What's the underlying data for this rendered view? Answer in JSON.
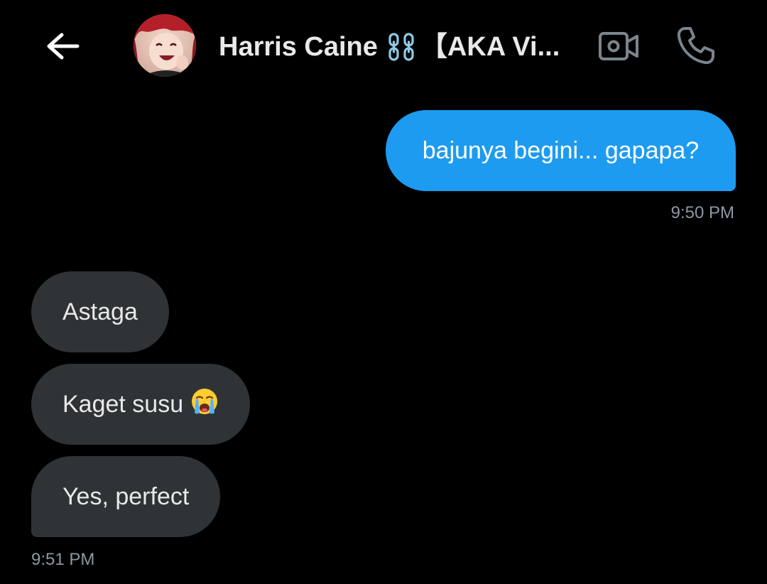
{
  "header": {
    "contact_name": "Harris Caine",
    "contact_name_suffix": "【AKA Vi...",
    "icons": {
      "back": "arrow-left-icon",
      "avatar": "avatar",
      "chain": "chain-link-icon",
      "video": "video-call-icon",
      "call": "phone-icon"
    }
  },
  "messages": {
    "outgoing": [
      {
        "text": "bajunya begini... gapapa?",
        "time": "9:50 PM"
      }
    ],
    "incoming": [
      {
        "text": "Astaga"
      },
      {
        "text": "Kaget susu",
        "emoji": "loudly-crying-face-icon"
      },
      {
        "text": "Yes, perfect",
        "time": "9:51 PM"
      }
    ]
  },
  "colors": {
    "background": "#000000",
    "outgoing_bubble": "#1d9bf0",
    "incoming_bubble": "#2f3336",
    "text_primary": "#e7e9ea",
    "text_secondary": "#8b98a5",
    "chain_icon": "#8ecae6"
  }
}
